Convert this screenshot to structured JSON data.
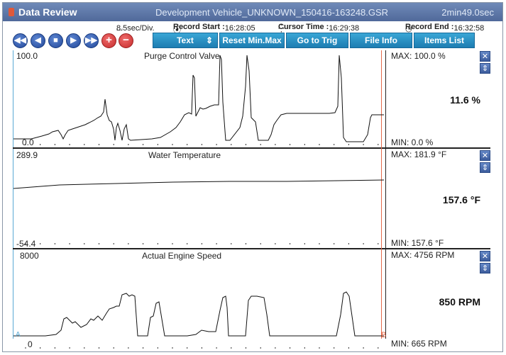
{
  "titlebar": {
    "app_title": "Data Review",
    "file_name": "Development Vehicle_UNKNOWN_150416-163248.GSR",
    "duration": "2min49.0sec"
  },
  "infobar": {
    "division": "8.5sec/Div.",
    "record_start_label": "Record Start :",
    "record_start_value": "16:28:05",
    "cursor_time_label": "Cursor Time :",
    "cursor_time_value": "16:29:38",
    "record_end_label": "Record End :",
    "record_end_value": "16:32:58"
  },
  "toolbar": {
    "text_label": "Text",
    "reset_label": "Reset Min.Max",
    "trig_label": "Go to Trig",
    "file_info_label": "File Info",
    "items_list_label": "Items List"
  },
  "panels": [
    {
      "title": "Purge Control Valve",
      "top_value": "100.0",
      "bottom_value": "0.0",
      "max_text": "MAX: 100.0 %",
      "min_text": "MIN:  0.0 %",
      "current_value": "11.6 %"
    },
    {
      "title": "Water Temperature",
      "top_value": "289.9",
      "bottom_value": "-54.4",
      "max_text": "MAX: 181.9 °F",
      "min_text": "MIN: 157.6 °F",
      "current_value": "157.6 °F"
    },
    {
      "title": "Actual Engine Speed",
      "top_value": "8000",
      "bottom_value": "0",
      "max_text": "MAX:  4756 RPM",
      "min_text": "MIN:  665 RPM",
      "current_value": "850 RPM"
    }
  ],
  "markers": {
    "a_label": "A",
    "b_label": "B"
  },
  "colors": {
    "titlebar": "#5b74a7",
    "toolbar_button": "#2a8fc4",
    "cursor": "#e46a4a",
    "trace": "#111111",
    "round_button": "#2f5bb3",
    "plus_minus": "#d63a3a"
  },
  "icons": [
    "rewind-icon",
    "step-back-icon",
    "stop-icon",
    "play-icon",
    "fast-forward-icon",
    "plus-icon",
    "minus-icon",
    "close-icon",
    "expand-icon"
  ]
}
